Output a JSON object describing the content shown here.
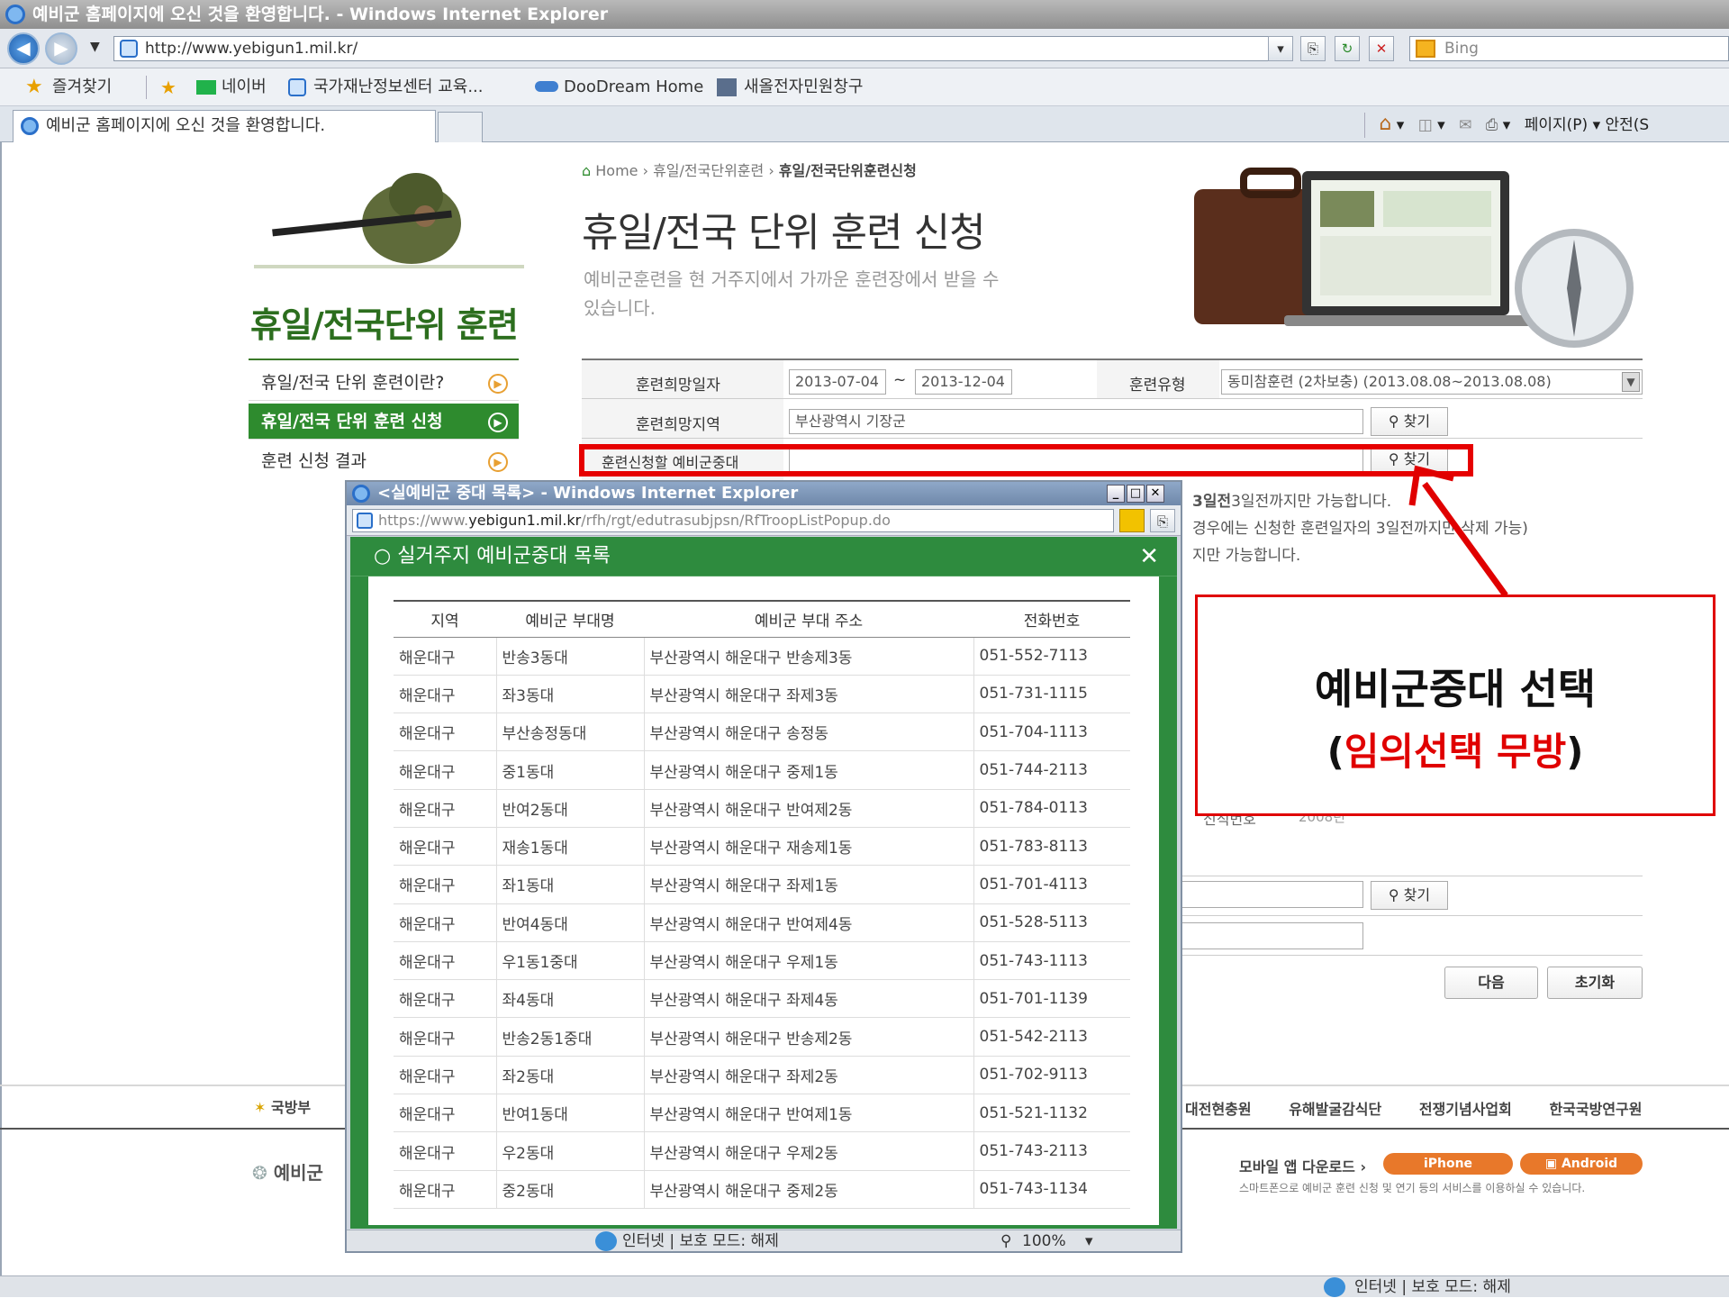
{
  "browser": {
    "window_title": "예비군 홈페이지에 오신 것을 환영합니다. - Windows Internet Explorer",
    "url": "http://www.yebigun1.mil.kr/",
    "search_provider": "Bing",
    "favorites": [
      "즐겨찾기",
      "네이버",
      "국가재난정보센터 교육...",
      "DooDream Home",
      "새올전자민원창구"
    ],
    "tab_title": "예비군 홈페이지에 오신 것을 환영합니다.",
    "command_bar": "페이지(P) ▾   안전(S",
    "status": "인터넷 | 보호 모드: 해제"
  },
  "sidebar": {
    "title": "휴일/전국단위 훈련",
    "items": [
      {
        "label": "휴일/전국 단위 훈련이란?"
      },
      {
        "label": "휴일/전국 단위 훈련 신청"
      },
      {
        "label": "훈련 신청 결과"
      }
    ]
  },
  "main": {
    "breadcrumb": [
      "Home",
      "휴일/전국단위훈련",
      "휴일/전국단위훈련신청"
    ],
    "title": "휴일/전국 단위 훈련 신청",
    "subtitle": "예비군훈련을 현 거주지에서 가까운 훈련장에서 받을 수 있습니다.",
    "form": {
      "date_label": "훈련희망일자",
      "date_from": "2013-07-04",
      "date_sep": "~",
      "date_to": "2013-12-04",
      "type_label": "훈련유형",
      "type_value": "동미참훈련 (2차보충) (2013.08.08~2013.08.08)",
      "region_label": "훈련희망지역",
      "region_value": "부산광역시 기장군",
      "unit_label": "훈련신청할 예비군중대",
      "find_label": "찾기"
    },
    "notices": [
      "3일전까지만 가능합니다.",
      "경우에는 신청한 훈련일자의 3일전까지만 삭제 가능)",
      "지만 가능합니다."
    ],
    "notice_bold": "3일전",
    "partial_label": "신직번호",
    "partial_value": "2008년",
    "next_button": "다음",
    "reset_button": "초기화"
  },
  "footer": {
    "mnd": "국방부",
    "links": [
      "대전현충원",
      "유해발굴감식단",
      "전쟁기념사업회",
      "한국국방연구원"
    ],
    "logo": "예비군",
    "app_download": "모바일 앱 다운로드",
    "iphone": "iPhone",
    "android": "Android",
    "app_desc": "스마트폰으로 예비군 훈련 신청 및 연기 등의 서비스를 이용하실 수 있습니다."
  },
  "callout": {
    "line1": "예비군중대 선택",
    "line2_open": "(",
    "line2_red": "임의선택 무방",
    "line2_close": ")"
  },
  "popup": {
    "window_title": "<실예비군 중대 목록> - Windows Internet Explorer",
    "url_prefix": "https://www.",
    "url_domain": "yebigun1.mil.kr",
    "url_path": "/rfh/rgt/edutrasubjpsn/RfTroopListPopup.do",
    "heading": "실거주지 예비군중대 목록",
    "columns": [
      "지역",
      "예비군 부대명",
      "예비군 부대 주소",
      "전화번호"
    ],
    "rows": [
      [
        "해운대구",
        "반송3동대",
        "부산광역시 해운대구 반송제3동",
        "051-552-7113"
      ],
      [
        "해운대구",
        "좌3동대",
        "부산광역시 해운대구 좌제3동",
        "051-731-1115"
      ],
      [
        "해운대구",
        "부산송정동대",
        "부산광역시 해운대구 송정동",
        "051-704-1113"
      ],
      [
        "해운대구",
        "중1동대",
        "부산광역시 해운대구 중제1동",
        "051-744-2113"
      ],
      [
        "해운대구",
        "반여2동대",
        "부산광역시 해운대구 반여제2동",
        "051-784-0113"
      ],
      [
        "해운대구",
        "재송1동대",
        "부산광역시 해운대구 재송제1동",
        "051-783-8113"
      ],
      [
        "해운대구",
        "좌1동대",
        "부산광역시 해운대구 좌제1동",
        "051-701-4113"
      ],
      [
        "해운대구",
        "반여4동대",
        "부산광역시 해운대구 반여제4동",
        "051-528-5113"
      ],
      [
        "해운대구",
        "우1동1중대",
        "부산광역시 해운대구 우제1동",
        "051-743-1113"
      ],
      [
        "해운대구",
        "좌4동대",
        "부산광역시 해운대구 좌제4동",
        "051-701-1139"
      ],
      [
        "해운대구",
        "반송2동1중대",
        "부산광역시 해운대구 반송제2동",
        "051-542-2113"
      ],
      [
        "해운대구",
        "좌2동대",
        "부산광역시 해운대구 좌제2동",
        "051-702-9113"
      ],
      [
        "해운대구",
        "반여1동대",
        "부산광역시 해운대구 반여제1동",
        "051-521-1132"
      ],
      [
        "해운대구",
        "우2동대",
        "부산광역시 해운대구 우제2동",
        "051-743-2113"
      ],
      [
        "해운대구",
        "중2동대",
        "부산광역시 해운대구 중제2동",
        "051-743-1134"
      ]
    ],
    "status": "인터넷 | 보호 모드: 해제",
    "zoom": "100%"
  },
  "colors": {
    "accent_green": "#2e8b2e",
    "callout_red": "#e60000",
    "sidebar_title": "#2c6e1e"
  }
}
